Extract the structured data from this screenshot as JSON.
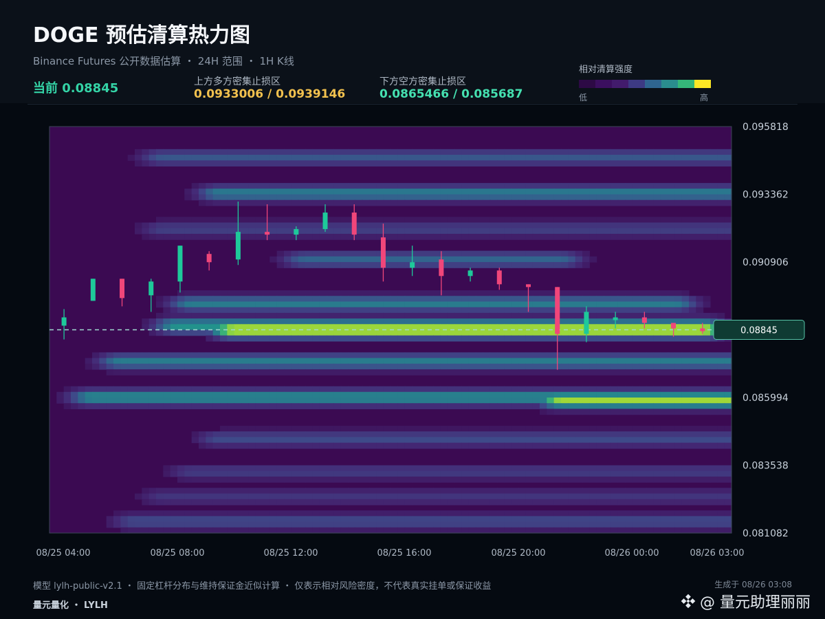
{
  "header": {
    "title": "DOGE 预估清算热力图",
    "subtitle": "Binance Futures 公开数据估算 ・ 24H 范围 ・ 1H K线",
    "current_label": "当前 0.08845",
    "above_label": "上方多方密集止损区",
    "above_value": "0.0933006 / 0.0939146",
    "below_label": "下方空方密集止损区",
    "below_value": "0.0865466 / 0.085687"
  },
  "colorbar": {
    "title": "相对清算强度",
    "low": "低",
    "high": "高",
    "colors": [
      "#2d0a45",
      "#3b0f5f",
      "#421b6c",
      "#3d3a83",
      "#2f6590",
      "#2a8d8e",
      "#35b779",
      "#fde725"
    ]
  },
  "chart_data": {
    "type": "heatmap",
    "title": "",
    "xlabel": "",
    "ylabel": "",
    "x_ticks": [
      "08/25 04:00",
      "08/25 08:00",
      "08/25 12:00",
      "08/25 16:00",
      "08/25 20:00",
      "08/26 00:00",
      "08/26 03:00"
    ],
    "y_ticks": [
      "0.095818",
      "0.093362",
      "0.090906",
      "0.088450",
      "0.085994",
      "0.083538",
      "0.081082"
    ],
    "ylim": [
      0.081082,
      0.095818
    ],
    "current_price": 0.08845,
    "current_price_label": "0.08845",
    "heat_bands": [
      {
        "price": 0.08845,
        "intensity": 1.0,
        "start_hour": 6.5,
        "end_hour": 23.0
      },
      {
        "price": 0.0886,
        "intensity": 0.65,
        "start_hour": 4.5,
        "end_hour": 23.0
      },
      {
        "price": 0.0894,
        "intensity": 0.55,
        "start_hour": 5.0,
        "end_hour": 22.0
      },
      {
        "price": 0.091,
        "intensity": 0.45,
        "start_hour": 9.0,
        "end_hour": 18.0
      },
      {
        "price": 0.0873,
        "intensity": 0.55,
        "start_hour": 2.5,
        "end_hour": 24.0
      },
      {
        "price": 0.086,
        "intensity": 0.62,
        "start_hour": 1.5,
        "end_hour": 24.0
      },
      {
        "price": 0.0859,
        "intensity": 0.9,
        "start_hour": 18.0,
        "end_hour": 24.0
      },
      {
        "price": 0.0934,
        "intensity": 0.55,
        "start_hour": 6.0,
        "end_hour": 24.0
      },
      {
        "price": 0.0947,
        "intensity": 0.4,
        "start_hour": 4.0,
        "end_hour": 24.0
      },
      {
        "price": 0.0921,
        "intensity": 0.3,
        "start_hour": 4.0,
        "end_hour": 24.0
      },
      {
        "price": 0.0845,
        "intensity": 0.35,
        "start_hour": 6.0,
        "end_hour": 24.0
      },
      {
        "price": 0.0833,
        "intensity": 0.28,
        "start_hour": 5.0,
        "end_hour": 24.0
      },
      {
        "price": 0.0824,
        "intensity": 0.25,
        "start_hour": 4.0,
        "end_hour": 24.0
      },
      {
        "price": 0.0815,
        "intensity": 0.35,
        "start_hour": 3.0,
        "end_hour": 24.0
      }
    ],
    "candles": [
      {
        "o": 0.0886,
        "h": 0.0892,
        "l": 0.0881,
        "c": 0.0889
      },
      {
        "o": 0.0895,
        "h": 0.0903,
        "l": 0.0895,
        "c": 0.0903
      },
      {
        "o": 0.0903,
        "h": 0.0903,
        "l": 0.0893,
        "c": 0.0896
      },
      {
        "o": 0.0897,
        "h": 0.0903,
        "l": 0.0891,
        "c": 0.0902
      },
      {
        "o": 0.0902,
        "h": 0.0915,
        "l": 0.0898,
        "c": 0.0915
      },
      {
        "o": 0.0912,
        "h": 0.0913,
        "l": 0.0906,
        "c": 0.0909
      },
      {
        "o": 0.091,
        "h": 0.0931,
        "l": 0.0908,
        "c": 0.092
      },
      {
        "o": 0.092,
        "h": 0.093,
        "l": 0.0917,
        "c": 0.0919
      },
      {
        "o": 0.0919,
        "h": 0.0922,
        "l": 0.0917,
        "c": 0.0921
      },
      {
        "o": 0.0921,
        "h": 0.093,
        "l": 0.092,
        "c": 0.0927
      },
      {
        "o": 0.0927,
        "h": 0.093,
        "l": 0.0917,
        "c": 0.0919
      },
      {
        "o": 0.0918,
        "h": 0.0923,
        "l": 0.0902,
        "c": 0.0907
      },
      {
        "o": 0.0907,
        "h": 0.0915,
        "l": 0.0904,
        "c": 0.0909
      },
      {
        "o": 0.091,
        "h": 0.0913,
        "l": 0.0897,
        "c": 0.0904
      },
      {
        "o": 0.0904,
        "h": 0.0907,
        "l": 0.0902,
        "c": 0.0906
      },
      {
        "o": 0.0906,
        "h": 0.0907,
        "l": 0.0899,
        "c": 0.0901
      },
      {
        "o": 0.0901,
        "h": 0.0901,
        "l": 0.0891,
        "c": 0.09
      },
      {
        "o": 0.09,
        "h": 0.09,
        "l": 0.087,
        "c": 0.0883
      },
      {
        "o": 0.0883,
        "h": 0.0893,
        "l": 0.088,
        "c": 0.0891
      },
      {
        "o": 0.0888,
        "h": 0.0891,
        "l": 0.0885,
        "c": 0.0889
      },
      {
        "o": 0.0889,
        "h": 0.0891,
        "l": 0.0885,
        "c": 0.0887
      },
      {
        "o": 0.0887,
        "h": 0.0887,
        "l": 0.0882,
        "c": 0.0885
      },
      {
        "o": 0.0885,
        "h": 0.0887,
        "l": 0.0883,
        "c": 0.0884
      }
    ],
    "up_color": "#1ec99a",
    "down_color": "#f0467a"
  },
  "footer": {
    "note": "模型 lylh-public-v2.1 ・ 固定杠杆分布与维持保证金近似计算 ・ 仅表示相对风险密度，不代表真实挂单或保证收益",
    "brand": "量元量化 ・ LYLH",
    "generated": "生成于 08/26 03:08",
    "watermark": "@ 量元助理丽丽"
  }
}
